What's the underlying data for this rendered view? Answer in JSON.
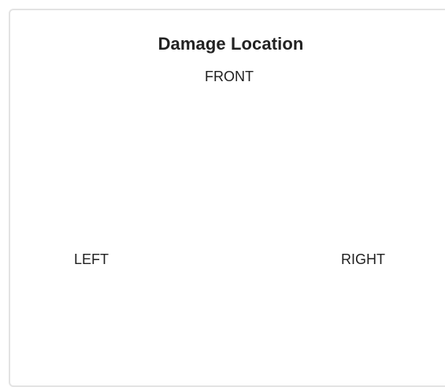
{
  "card": {
    "title": "Damage Location"
  },
  "diagram": {
    "front_label": "FRONT",
    "left_label": "LEFT",
    "right_label": "RIGHT"
  }
}
